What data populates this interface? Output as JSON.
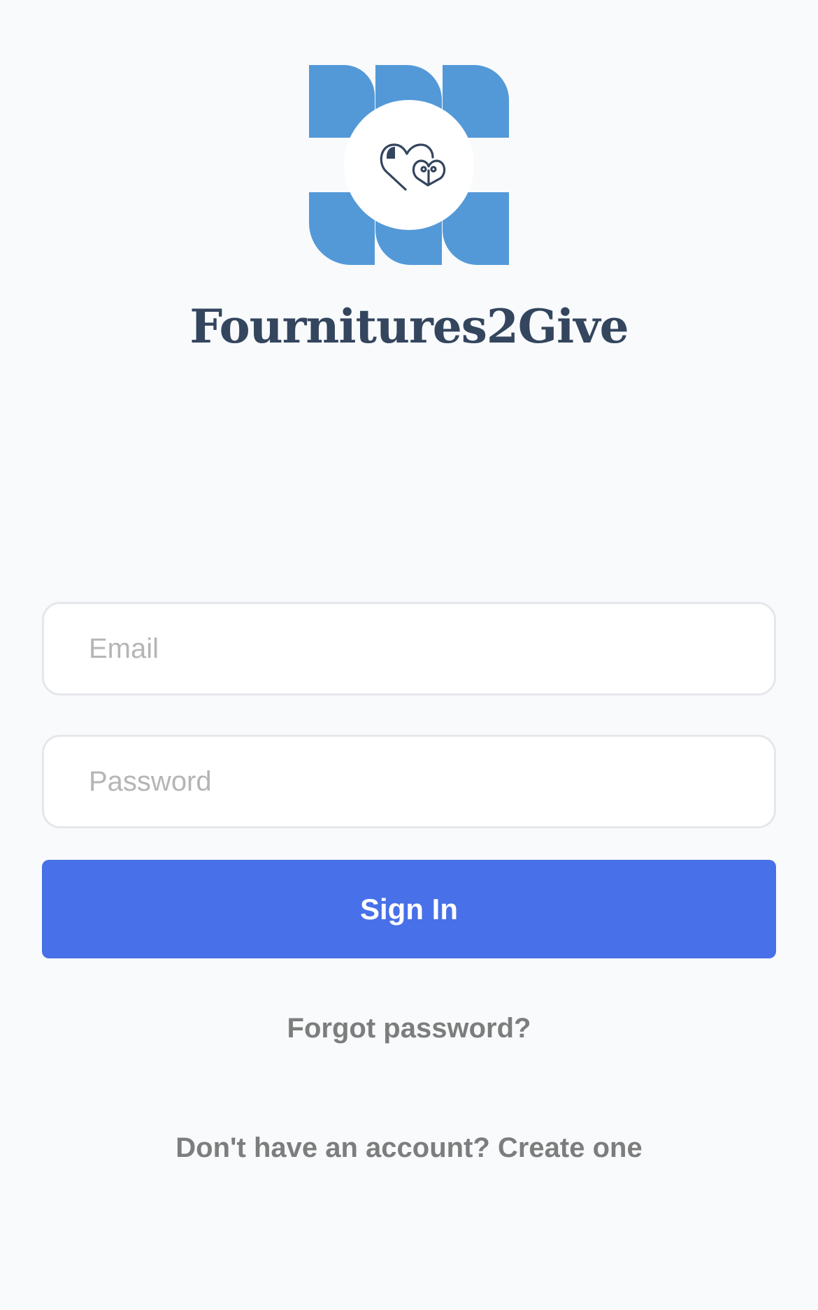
{
  "app": {
    "title": "Fournitures2Give"
  },
  "logo": {
    "icon": "hearts-logo-icon",
    "accent_color": "#5399d8",
    "icon_color": "#34455e"
  },
  "form": {
    "email_placeholder": "Email",
    "email_value": "",
    "password_placeholder": "Password",
    "password_value": "",
    "signin_label": "Sign In"
  },
  "links": {
    "forgot": "Forgot password?",
    "create": "Don't have an account? Create one"
  },
  "colors": {
    "background": "#f8fafc",
    "primary": "#4870e8",
    "link": "#7d7d7d"
  }
}
